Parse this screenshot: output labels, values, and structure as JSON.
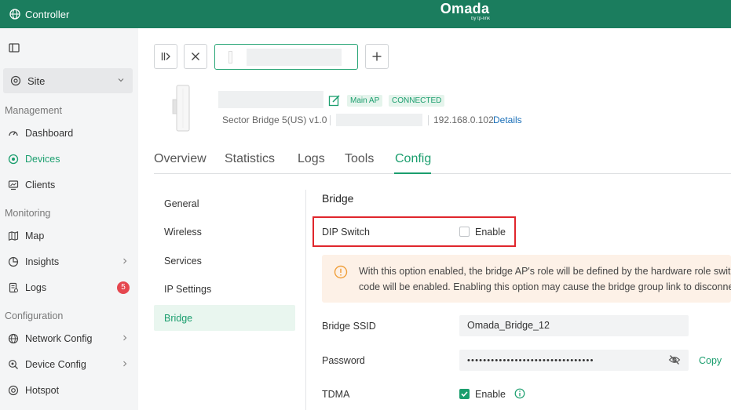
{
  "topbar": {
    "controller_label": "Controller",
    "logo_main": "Omada",
    "logo_sub": "by tp-link",
    "bg_color": "#1b7d5e"
  },
  "sidebar": {
    "site_label": "Site",
    "sections": {
      "management": "Management",
      "monitoring": "Monitoring",
      "configuration": "Configuration"
    },
    "items": {
      "dashboard": "Dashboard",
      "devices": "Devices",
      "clients": "Clients",
      "map": "Map",
      "insights": "Insights",
      "logs": "Logs",
      "logs_badge": "5",
      "network_config": "Network Config",
      "device_config": "Device Config",
      "hotspot": "Hotspot"
    },
    "active_item": "Devices",
    "accent_color": "#1b9e6e"
  },
  "device": {
    "tag_main_ap": "Main AP",
    "tag_status": "CONNECTED",
    "model": "Sector Bridge 5(US) v1.0",
    "ip": "192.168.0.102",
    "details_link": "Details"
  },
  "tabs": {
    "overview": "Overview",
    "statistics": "Statistics",
    "logs": "Logs",
    "tools": "Tools",
    "config": "Config",
    "active": "Config"
  },
  "subnav": {
    "general": "General",
    "wireless": "Wireless",
    "services": "Services",
    "ip_settings": "IP Settings",
    "bridge": "Bridge",
    "active": "Bridge"
  },
  "bridge": {
    "title": "Bridge",
    "dip_switch_label": "DIP Switch",
    "dip_switch_enable": "Enable",
    "dip_switch_checked": false,
    "warning_line1": "With this option enabled, the bridge AP's role will be defined by the hardware role switch o",
    "warning_line2": "code will be enabled. Enabling this option may cause the bridge group link to disconnect.",
    "ssid_label": "Bridge SSID",
    "ssid_value": "Omada_Bridge_12",
    "password_label": "Password",
    "password_value": "••••••••••••••••••••••••••••••••",
    "copy_label": "Copy",
    "tdma_label": "TDMA",
    "tdma_enable": "Enable",
    "tdma_checked": true
  }
}
